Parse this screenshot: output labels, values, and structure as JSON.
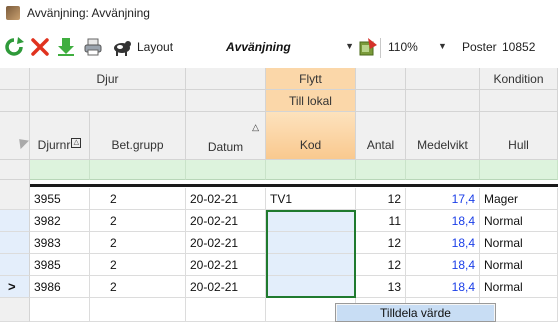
{
  "window": {
    "title": "Avvänjning: Avvänjning"
  },
  "toolbar": {
    "layout_label": "Layout",
    "layout_value": "Avvänjning",
    "zoom_value": "110%",
    "post_label": "Poster",
    "post_value": "10852"
  },
  "grid": {
    "group_headers": {
      "djur": "Djur",
      "flytt": "Flytt",
      "kondition": "Kondition"
    },
    "subgroup": {
      "till_lokal": "Till lokal"
    },
    "columns": {
      "djurnr": "Djurnr",
      "betgrupp": "Bet.grupp",
      "datum": "Datum",
      "kod": "Kod",
      "antal": "Antal",
      "medelvikt": "Medelvikt",
      "hull": "Hull"
    },
    "rows": [
      {
        "djurnr": "3955",
        "betgrupp": "2",
        "datum": "20-02-21",
        "kod": "TV1",
        "antal": "12",
        "medelvikt": "17,4",
        "hull": "Mager"
      },
      {
        "djurnr": "3982",
        "betgrupp": "2",
        "datum": "20-02-21",
        "kod": "",
        "antal": "11",
        "medelvikt": "18,4",
        "hull": "Normal"
      },
      {
        "djurnr": "3983",
        "betgrupp": "2",
        "datum": "20-02-21",
        "kod": "",
        "antal": "12",
        "medelvikt": "18,4",
        "hull": "Normal"
      },
      {
        "djurnr": "3985",
        "betgrupp": "2",
        "datum": "20-02-21",
        "kod": "",
        "antal": "12",
        "medelvikt": "18,4",
        "hull": "Normal"
      },
      {
        "djurnr": "3986",
        "betgrupp": "2",
        "datum": "20-02-21",
        "kod": "",
        "antal": "13",
        "medelvikt": "18,4",
        "hull": "Normal"
      }
    ],
    "current_row_marker": ">"
  },
  "context_menu": {
    "item": "Tilldela värde"
  },
  "colors": {
    "selection_border": "#1f7a2e",
    "filter_row": "#ddf3dd",
    "flytt_header": "#fbd7a9",
    "value_blue": "#1a3ee8"
  }
}
